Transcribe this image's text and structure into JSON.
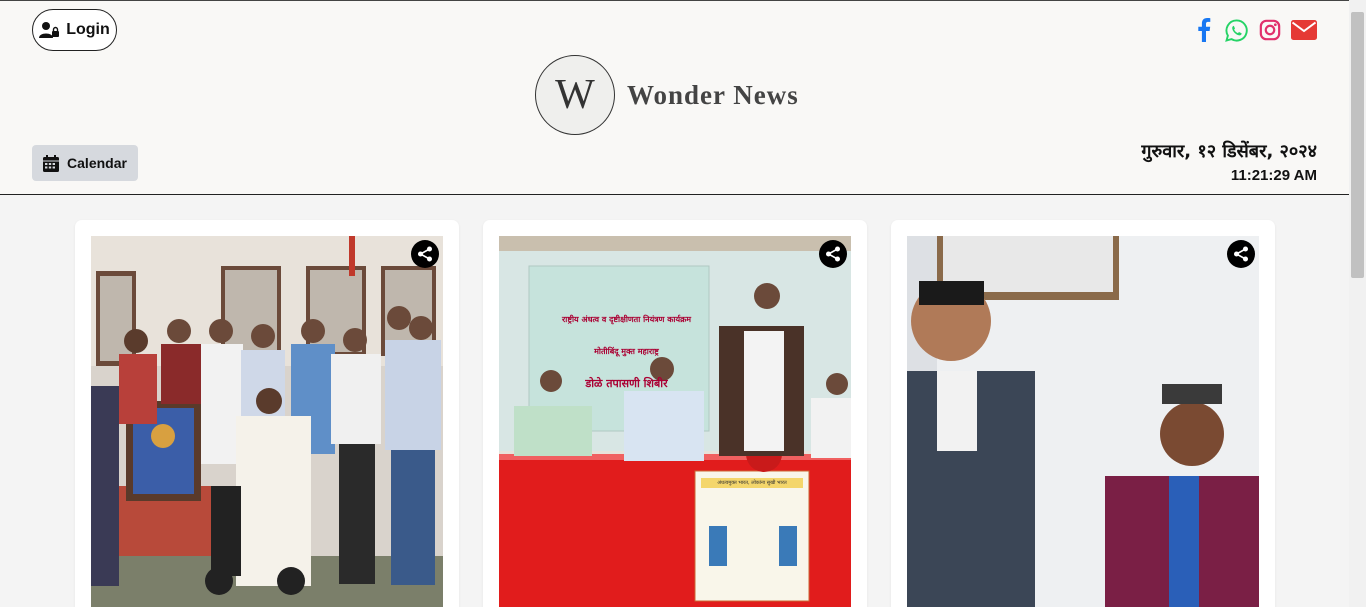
{
  "header": {
    "login_label": "Login",
    "brand_initial": "W",
    "brand_name": "Wonder News",
    "calendar_label": "Calendar",
    "date": "गुरुवार, १२ डिसेंबर, २०२४",
    "time": "11:21:29 AM"
  },
  "social": [
    {
      "name": "facebook-icon",
      "color": "#1877f2"
    },
    {
      "name": "whatsapp-icon",
      "color": "#25d366"
    },
    {
      "name": "instagram-icon",
      "color": "#e1306c"
    },
    {
      "name": "mail-icon",
      "color": "#e53935"
    }
  ],
  "cards": [
    {
      "image": "group-photo-felicitation"
    },
    {
      "image": "eye-checkup-camp-stage",
      "banner_line_1": "राष्ट्रीय अंधत्व व दृष्टीक्षीणता नियंत्रण कार्यक्रम",
      "banner_line_2": "मोतीबिंदू मुक्त महाराष्ट्र",
      "banner_line_3": "डोळे तपासणी शिबीर",
      "poster_title": "अंधत्वमुक्त भारत, लोकांना सुखी भारत"
    },
    {
      "image": "two-people-portrait"
    }
  ],
  "colors": {
    "accent": "#222222",
    "header_bg": "#f9f8f6",
    "calendar_bg": "#d6d9de"
  }
}
